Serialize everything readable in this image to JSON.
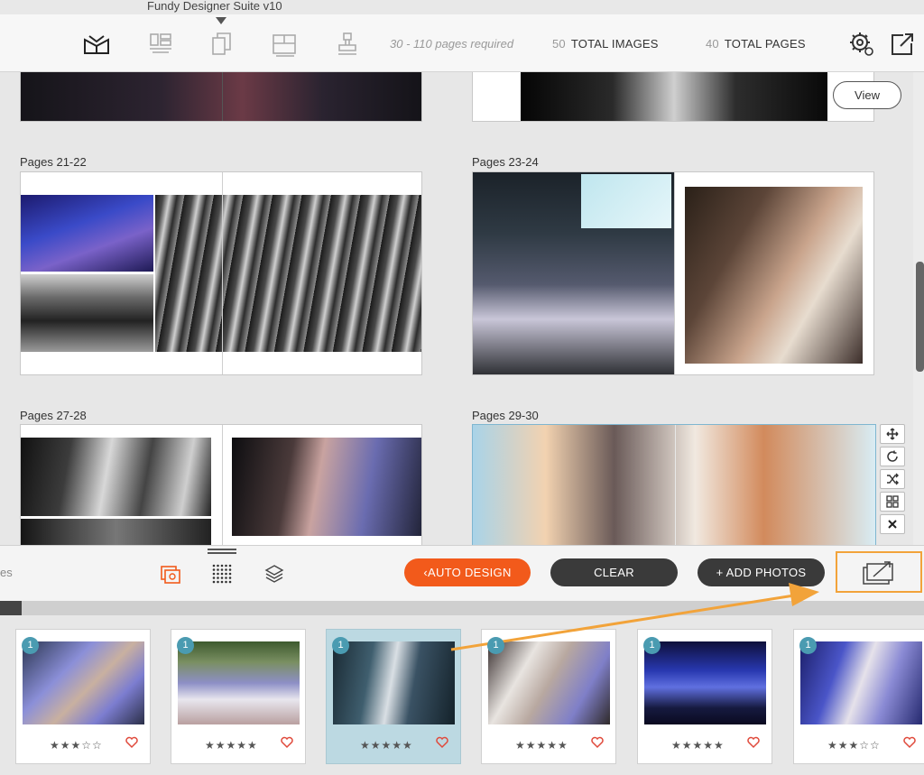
{
  "app": {
    "title": "Fundy Designer Suite v10"
  },
  "toolbar": {
    "icons": [
      "album-icon",
      "layout-icon",
      "pages-icon",
      "template-icon",
      "stamp-icon"
    ],
    "pages_required": "30 - 110 pages required",
    "total_images_num": "50",
    "total_images_label": "TOTAL IMAGES",
    "total_pages_num": "40",
    "total_pages_label": "TOTAL PAGES",
    "right_icons": [
      "gear-icon",
      "export-icon"
    ]
  },
  "spreads": [
    {
      "label": "Pages 21-22"
    },
    {
      "label": "Pages 23-24"
    },
    {
      "label": "Pages 27-28"
    },
    {
      "label": "Pages 29-30"
    }
  ],
  "view_button": "View",
  "side_tools": [
    "move-icon",
    "rotate-icon",
    "shuffle-icon",
    "grid-icon",
    "close-icon"
  ],
  "actionbar": {
    "partial_text": "es",
    "auto_design": "AUTO DESIGN",
    "clear": "CLEAR",
    "add_photos": "+ ADD PHOTOS"
  },
  "progress": {
    "fraction": 0.023
  },
  "colors": {
    "accent": "#f25a1b",
    "badge": "#4a9bb1",
    "highlight": "#f2a33a",
    "selected": "#bcd9e2"
  },
  "filmstrip": [
    {
      "badge": "1",
      "rating": 3,
      "stars": "★★★☆☆",
      "selected": false
    },
    {
      "badge": "1",
      "rating": 5,
      "stars": "★★★★★",
      "selected": false
    },
    {
      "badge": "1",
      "rating": 5,
      "stars": "★★★★★",
      "selected": true
    },
    {
      "badge": "1",
      "rating": 5,
      "stars": "★★★★★",
      "selected": false
    },
    {
      "badge": "1",
      "rating": 5,
      "stars": "★★★★★",
      "selected": false
    },
    {
      "badge": "1",
      "rating": 3,
      "stars": "★★★☆☆",
      "selected": false
    }
  ]
}
